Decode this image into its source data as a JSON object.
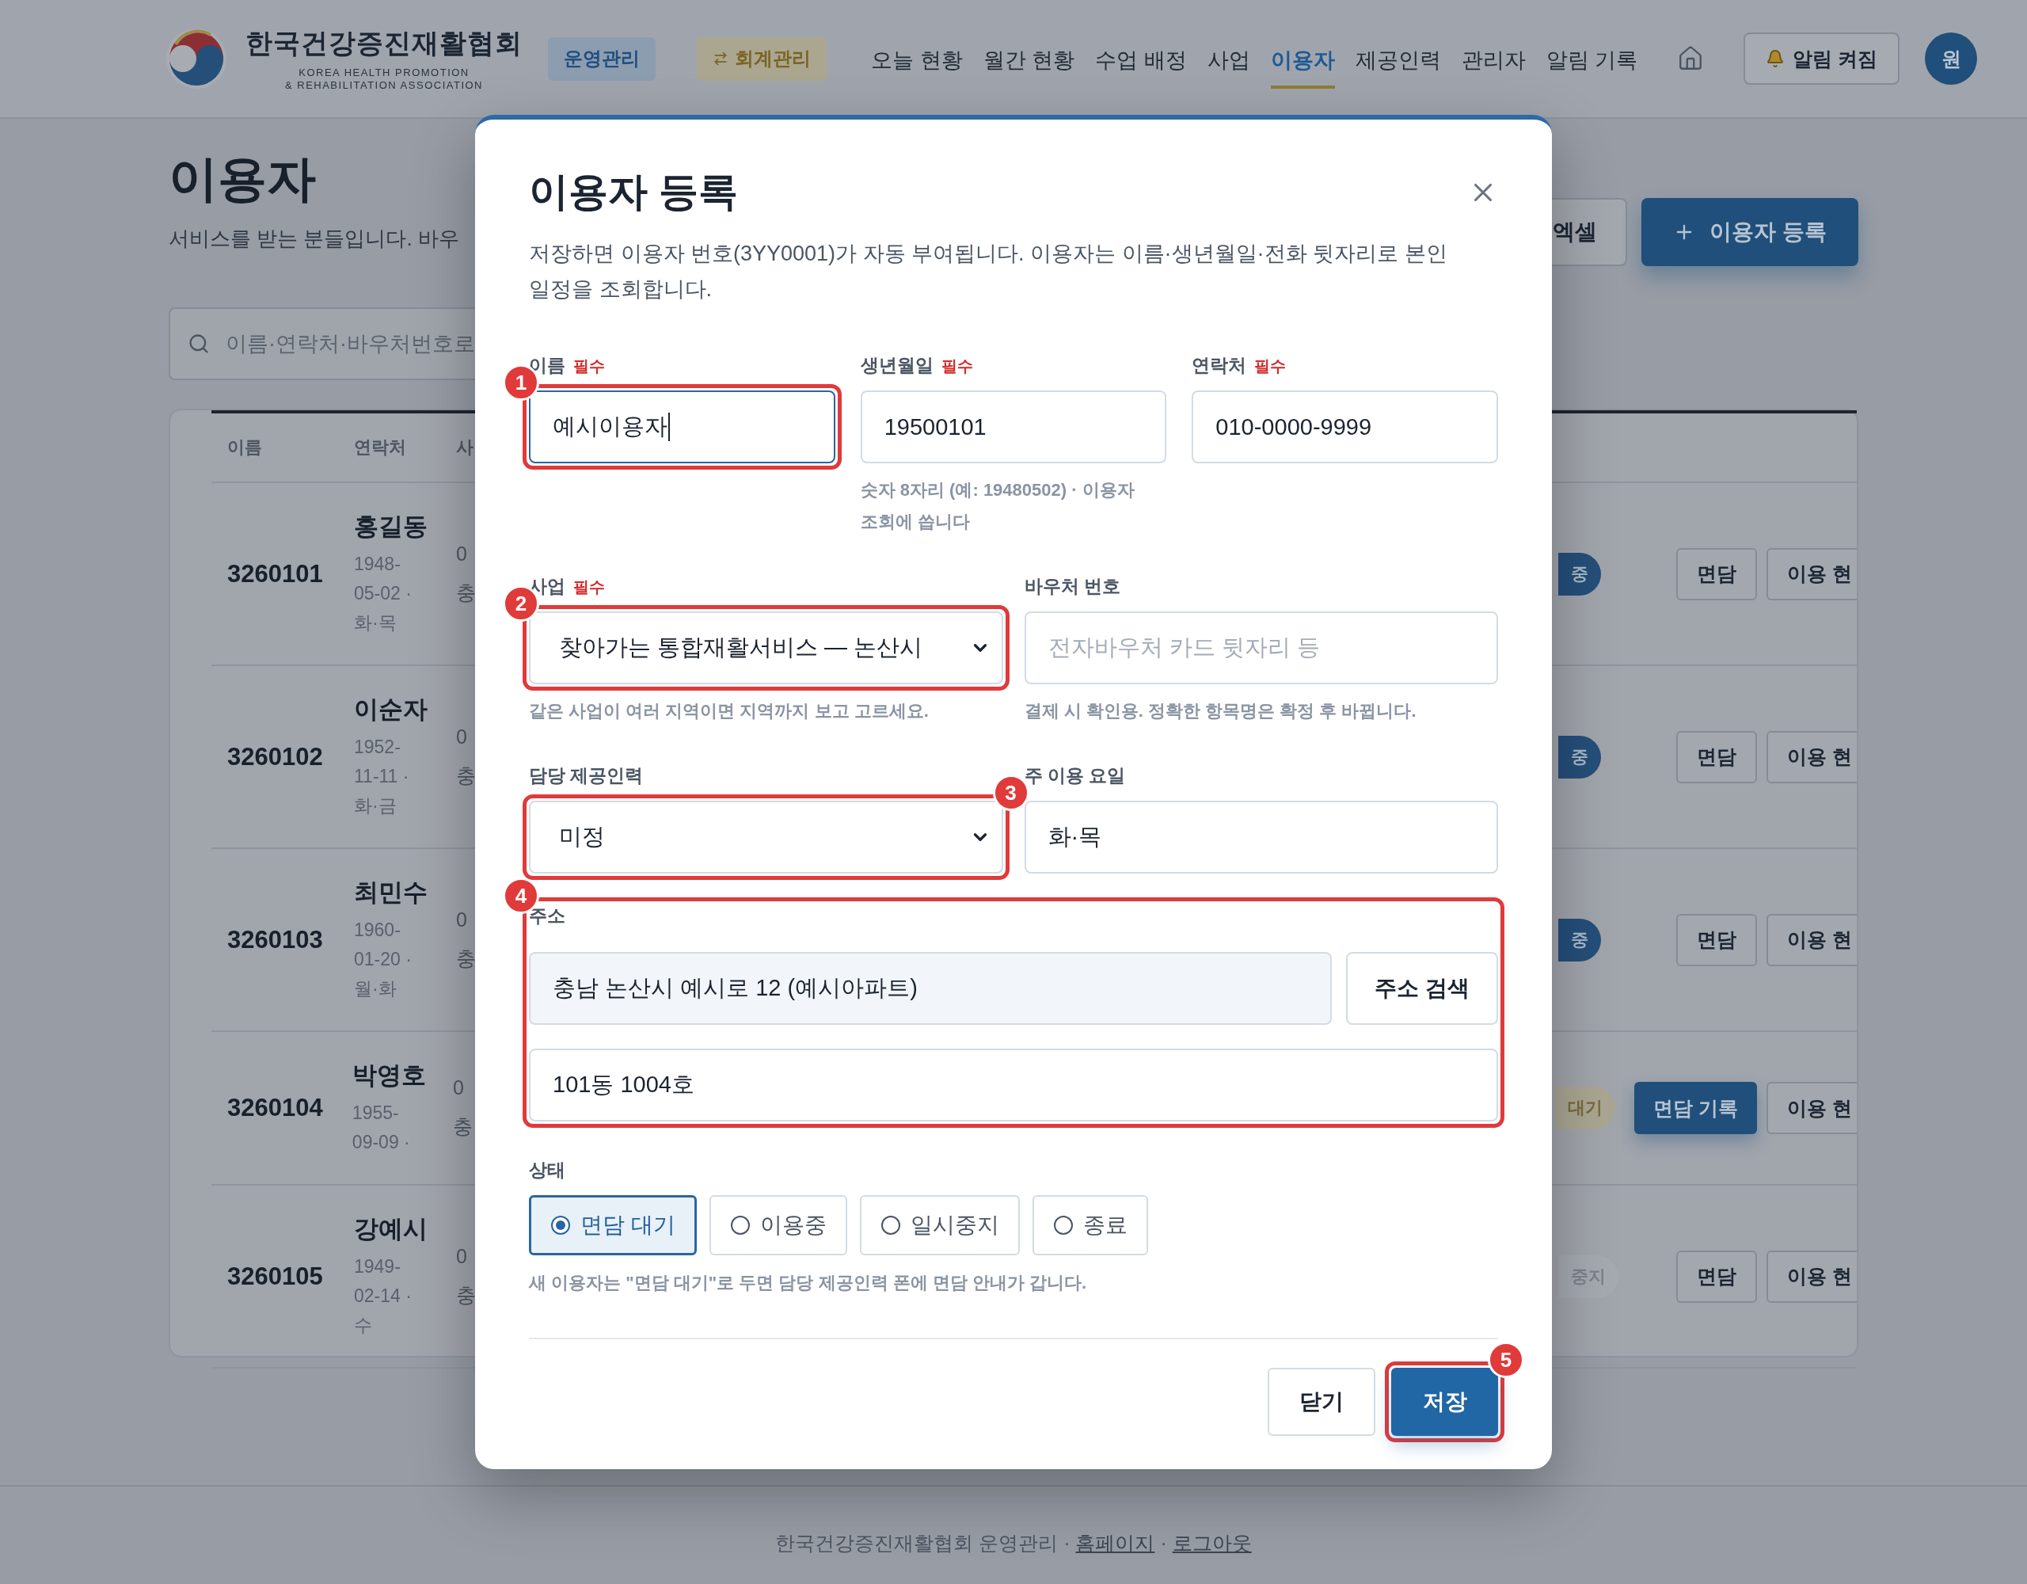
{
  "header": {
    "org_name": "한국건강증진재활협회",
    "org_subtitle": [
      "KOREA HEALTH PROMOTION",
      "& REHABILITATION ASSOCIATION"
    ],
    "modes": [
      {
        "label": "운영관리",
        "selected": true,
        "kind": "plain"
      },
      {
        "label": "회계관리",
        "selected": false,
        "kind": "swap"
      }
    ],
    "nav": [
      {
        "label": "오늘 현황",
        "selected": false
      },
      {
        "label": "월간 현황",
        "selected": false
      },
      {
        "label": "수업 배정",
        "selected": false
      },
      {
        "label": "사업",
        "selected": false
      },
      {
        "label": "이용자",
        "selected": true
      },
      {
        "label": "제공인력",
        "selected": false
      },
      {
        "label": "관리자",
        "selected": false
      },
      {
        "label": "알림 기록",
        "selected": false
      }
    ],
    "alert_button": "알림 켜짐",
    "avatar": "원"
  },
  "page": {
    "title": "이용자",
    "subtitle": "서비스를 받는 분들입니다. 바우",
    "search": {
      "placeholder": "이름·연락처·바우처번호로"
    },
    "excel_button": "엑셀",
    "add_button": "이용자 등록"
  },
  "table": {
    "columns": [
      "이름",
      "연락처",
      "사"
    ],
    "rows": [
      {
        "id": "3260101",
        "name": "홍길동",
        "details": "1948-05-02 · 화·목",
        "column_3": [
          "0",
          "충"
        ],
        "status": {
          "text": "중",
          "kind": "active"
        },
        "actions": [
          {
            "label": "면담",
            "kind": "outline"
          },
          {
            "label": "이용 현",
            "kind": "outline"
          }
        ]
      },
      {
        "id": "3260102",
        "name": "이순자",
        "details": "1952-11-11 · 화·금",
        "column_3": [
          "0",
          "충"
        ],
        "status": {
          "text": "중",
          "kind": "active"
        },
        "actions": [
          {
            "label": "면담",
            "kind": "outline"
          },
          {
            "label": "이용 현",
            "kind": "outline"
          }
        ]
      },
      {
        "id": "3260103",
        "name": "최민수",
        "details": "1960-01-20 · 월·화",
        "column_3": [
          "0",
          "충"
        ],
        "status": {
          "text": "중",
          "kind": "active"
        },
        "actions": [
          {
            "label": "면담",
            "kind": "outline"
          },
          {
            "label": "이용 현",
            "kind": "outline"
          }
        ]
      },
      {
        "id": "3260104",
        "name": "박영호",
        "details": "1955-09-09 ·",
        "column_3": [
          "0",
          "충"
        ],
        "status": {
          "text": "대기",
          "kind": "waiting"
        },
        "actions": [
          {
            "label": "면담 기록",
            "kind": "primary"
          },
          {
            "label": "이용 현",
            "kind": "outline"
          }
        ]
      },
      {
        "id": "3260105",
        "name": "강예시",
        "details": "1949-02-14 · 수",
        "column_3": [
          "0",
          "충"
        ],
        "status": {
          "text": "중지",
          "kind": "paused"
        },
        "actions": [
          {
            "label": "면담",
            "kind": "outline"
          },
          {
            "label": "이용 현",
            "kind": "outline"
          }
        ]
      }
    ]
  },
  "modal": {
    "title": "이용자 등록",
    "description": "저장하면 이용자 번호(3YY0001)가 자동 부여됩니다. 이용자는 이름·생년월일·전화 뒷자리로 본인 일정을 조회합니다.",
    "field_rows": [
      [
        {
          "label": "이름",
          "required": "필수",
          "kind": "input",
          "value": "예시이용자",
          "focused": true,
          "callout": {
            "number": "1",
            "right": false
          }
        },
        {
          "label": "생년월일",
          "required": "필수",
          "kind": "input",
          "value": "19500101",
          "focused": false,
          "hint": "숫자 8자리 (예: 19480502) · 이용자 조회에 씁니다"
        },
        {
          "label": "연락처",
          "required": "필수",
          "kind": "input",
          "value": "010-0000-9999",
          "focused": false
        }
      ],
      [
        {
          "label": "사업",
          "required": "필수",
          "kind": "select",
          "value": "찾아가는 통합재활서비스 — 논산시",
          "hint": "같은 사업이 여러 지역이면 지역까지 보고 고르세요.",
          "callout": {
            "number": "2",
            "right": false
          }
        },
        {
          "label": "바우처 번호",
          "kind": "input",
          "placeholder": "전자바우처 카드 뒷자리 등",
          "focused": false,
          "hint": "결제 시 확인용. 정확한 항목명은 확정 후 바뀝니다."
        }
      ],
      [
        {
          "label": "담당 제공인력",
          "kind": "select",
          "value": "미정",
          "callout": {
            "number": "3",
            "right": true
          }
        },
        {
          "label": "주 이용 요일",
          "kind": "input",
          "value": "화·목",
          "focused": false
        }
      ]
    ],
    "address": {
      "label": "주소",
      "value": "충남 논산시 예시로 12 (예시아파트)",
      "search_button": "주소 검색",
      "detail_value": "101동 1004호",
      "callout": {
        "number": "4",
        "right": false
      }
    },
    "status": {
      "label": "상태",
      "options": [
        {
          "label": "면담 대기",
          "selected": true
        },
        {
          "label": "이용중",
          "selected": false
        },
        {
          "label": "일시중지",
          "selected": false
        },
        {
          "label": "종료",
          "selected": false
        }
      ],
      "note": "새 이용자는 \"면담 대기\"로 두면 담당 제공인력 폰에 면담 안내가 갑니다."
    },
    "close_button": "닫기",
    "save_button": "저장",
    "save_callout": {
      "number": "5",
      "right": true
    }
  },
  "footer": {
    "parts": [
      {
        "text": "한국건강증진재활협회 운영관리 · ",
        "link": false
      },
      {
        "text": "홈페이지",
        "link": true
      },
      {
        "text": " · ",
        "link": false
      },
      {
        "text": "로그아웃",
        "link": true
      }
    ]
  }
}
